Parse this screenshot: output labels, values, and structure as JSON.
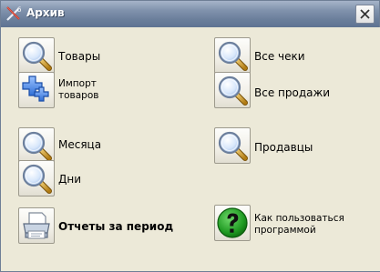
{
  "window": {
    "title": "Архив",
    "app_icon": "archive-tools-icon",
    "close_icon": "close-icon"
  },
  "left_column": {
    "goods": {
      "label": "Товары",
      "icon": "magnifier-icon"
    },
    "import_goods": {
      "label_line1": "Импорт",
      "label_line2": "товаров",
      "icon": "plus-icon"
    },
    "months": {
      "label": "Месяца",
      "icon": "magnifier-icon"
    },
    "days": {
      "label": "Дни",
      "icon": "magnifier-icon"
    },
    "period_reports": {
      "label": "Отчеты за период",
      "icon": "printer-icon"
    }
  },
  "right_column": {
    "all_receipts": {
      "label": "Все чеки",
      "icon": "magnifier-icon"
    },
    "all_sales": {
      "label": "Все продажи",
      "icon": "magnifier-icon"
    },
    "sellers": {
      "label": "Продавцы",
      "icon": "magnifier-icon"
    },
    "how_to_use": {
      "label_line1": "Как пользоваться",
      "label_line2": "программой",
      "icon": "help-icon"
    }
  },
  "colors": {
    "titlebar": "#7487a3",
    "window_bg": "#ece9d8",
    "help_green": "#1f8f1f",
    "plus_blue": "#3d7fe0"
  }
}
